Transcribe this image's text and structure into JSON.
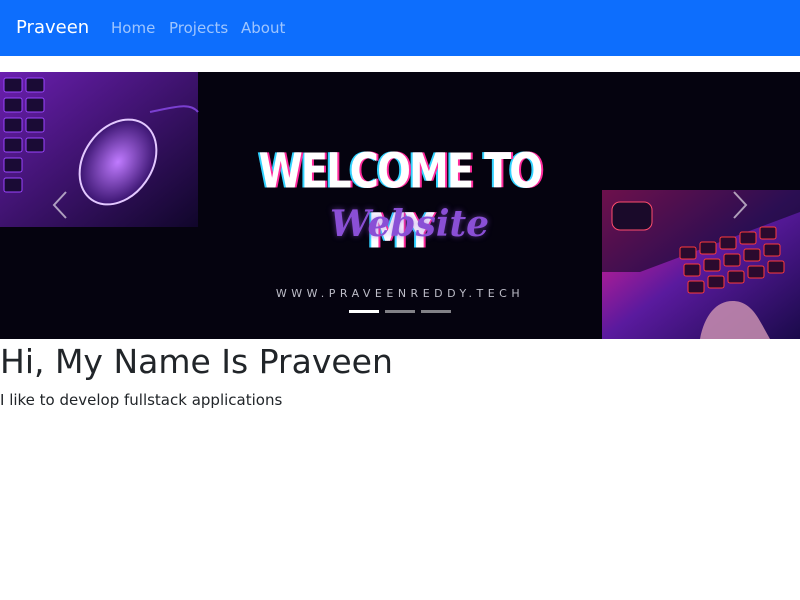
{
  "navbar": {
    "brand": "Praveen",
    "links": [
      {
        "label": "Home"
      },
      {
        "label": "Projects"
      },
      {
        "label": "About"
      }
    ],
    "background_color": "#0d6efd"
  },
  "carousel": {
    "slide": {
      "headline": "WELCOME TO MY",
      "script_text": "Website",
      "url_text": "WWW.PRAVEENREDDY.TECH"
    },
    "controls": {
      "prev_icon": "chevron-left-icon",
      "next_icon": "chevron-right-icon"
    },
    "indicator_count": 3,
    "active_indicator": 1
  },
  "main": {
    "heading": "Hi, My Name Is Praveen",
    "tagline": "I like to develop fullstack applications"
  }
}
